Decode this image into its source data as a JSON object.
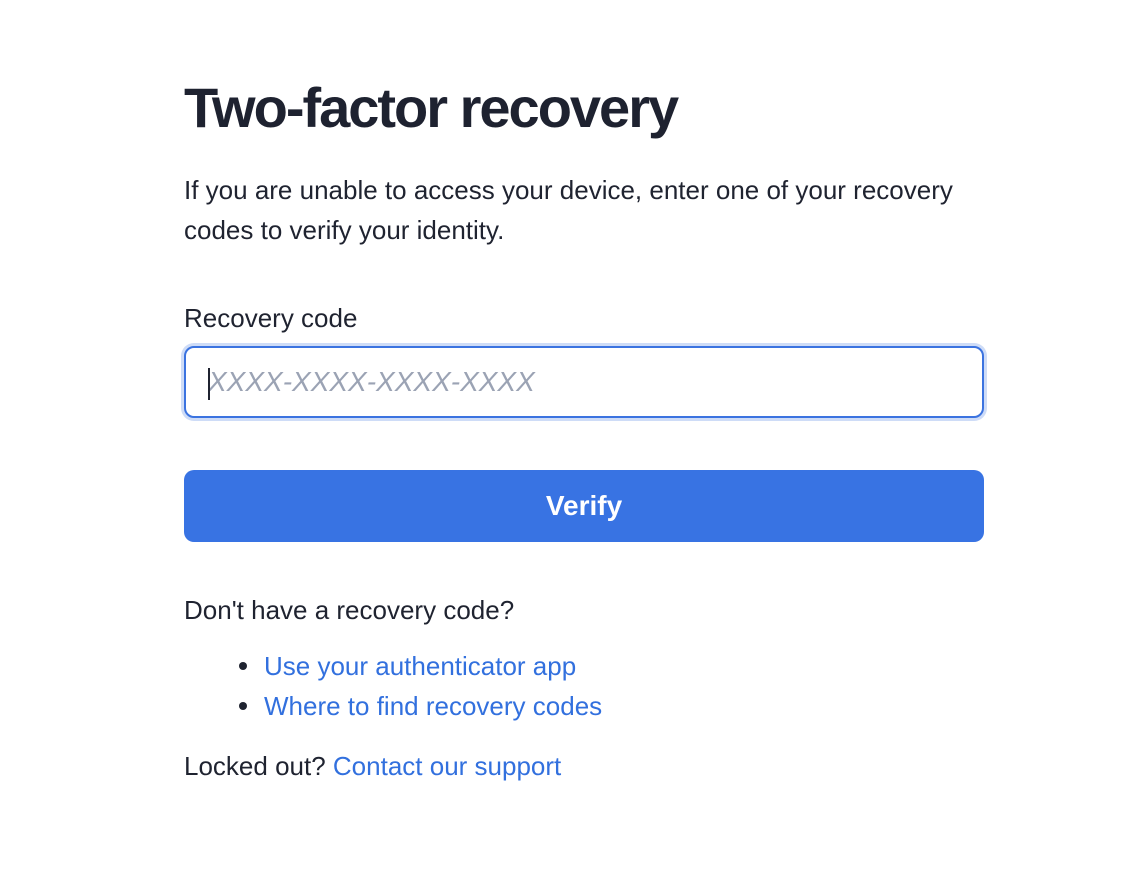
{
  "page": {
    "title": "Two-factor recovery",
    "intro": "If you are unable to access your device, enter one of your recovery codes to verify your identity."
  },
  "form": {
    "recovery_code_label": "Recovery code",
    "recovery_code_placeholder": "XXXX-XXXX-XXXX-XXXX",
    "recovery_code_value": "",
    "verify_label": "Verify"
  },
  "help": {
    "no_code_text": "Don't have a recovery code?",
    "options": [
      {
        "label": "Use your authenticator app"
      },
      {
        "label": "Where to find recovery codes"
      }
    ],
    "locked_out_text": "Locked out?",
    "support_link": "Contact our support"
  },
  "colors": {
    "accent": "#3873e3",
    "link": "#3270de",
    "text": "#1f2330",
    "placeholder": "#9ba3b4"
  }
}
